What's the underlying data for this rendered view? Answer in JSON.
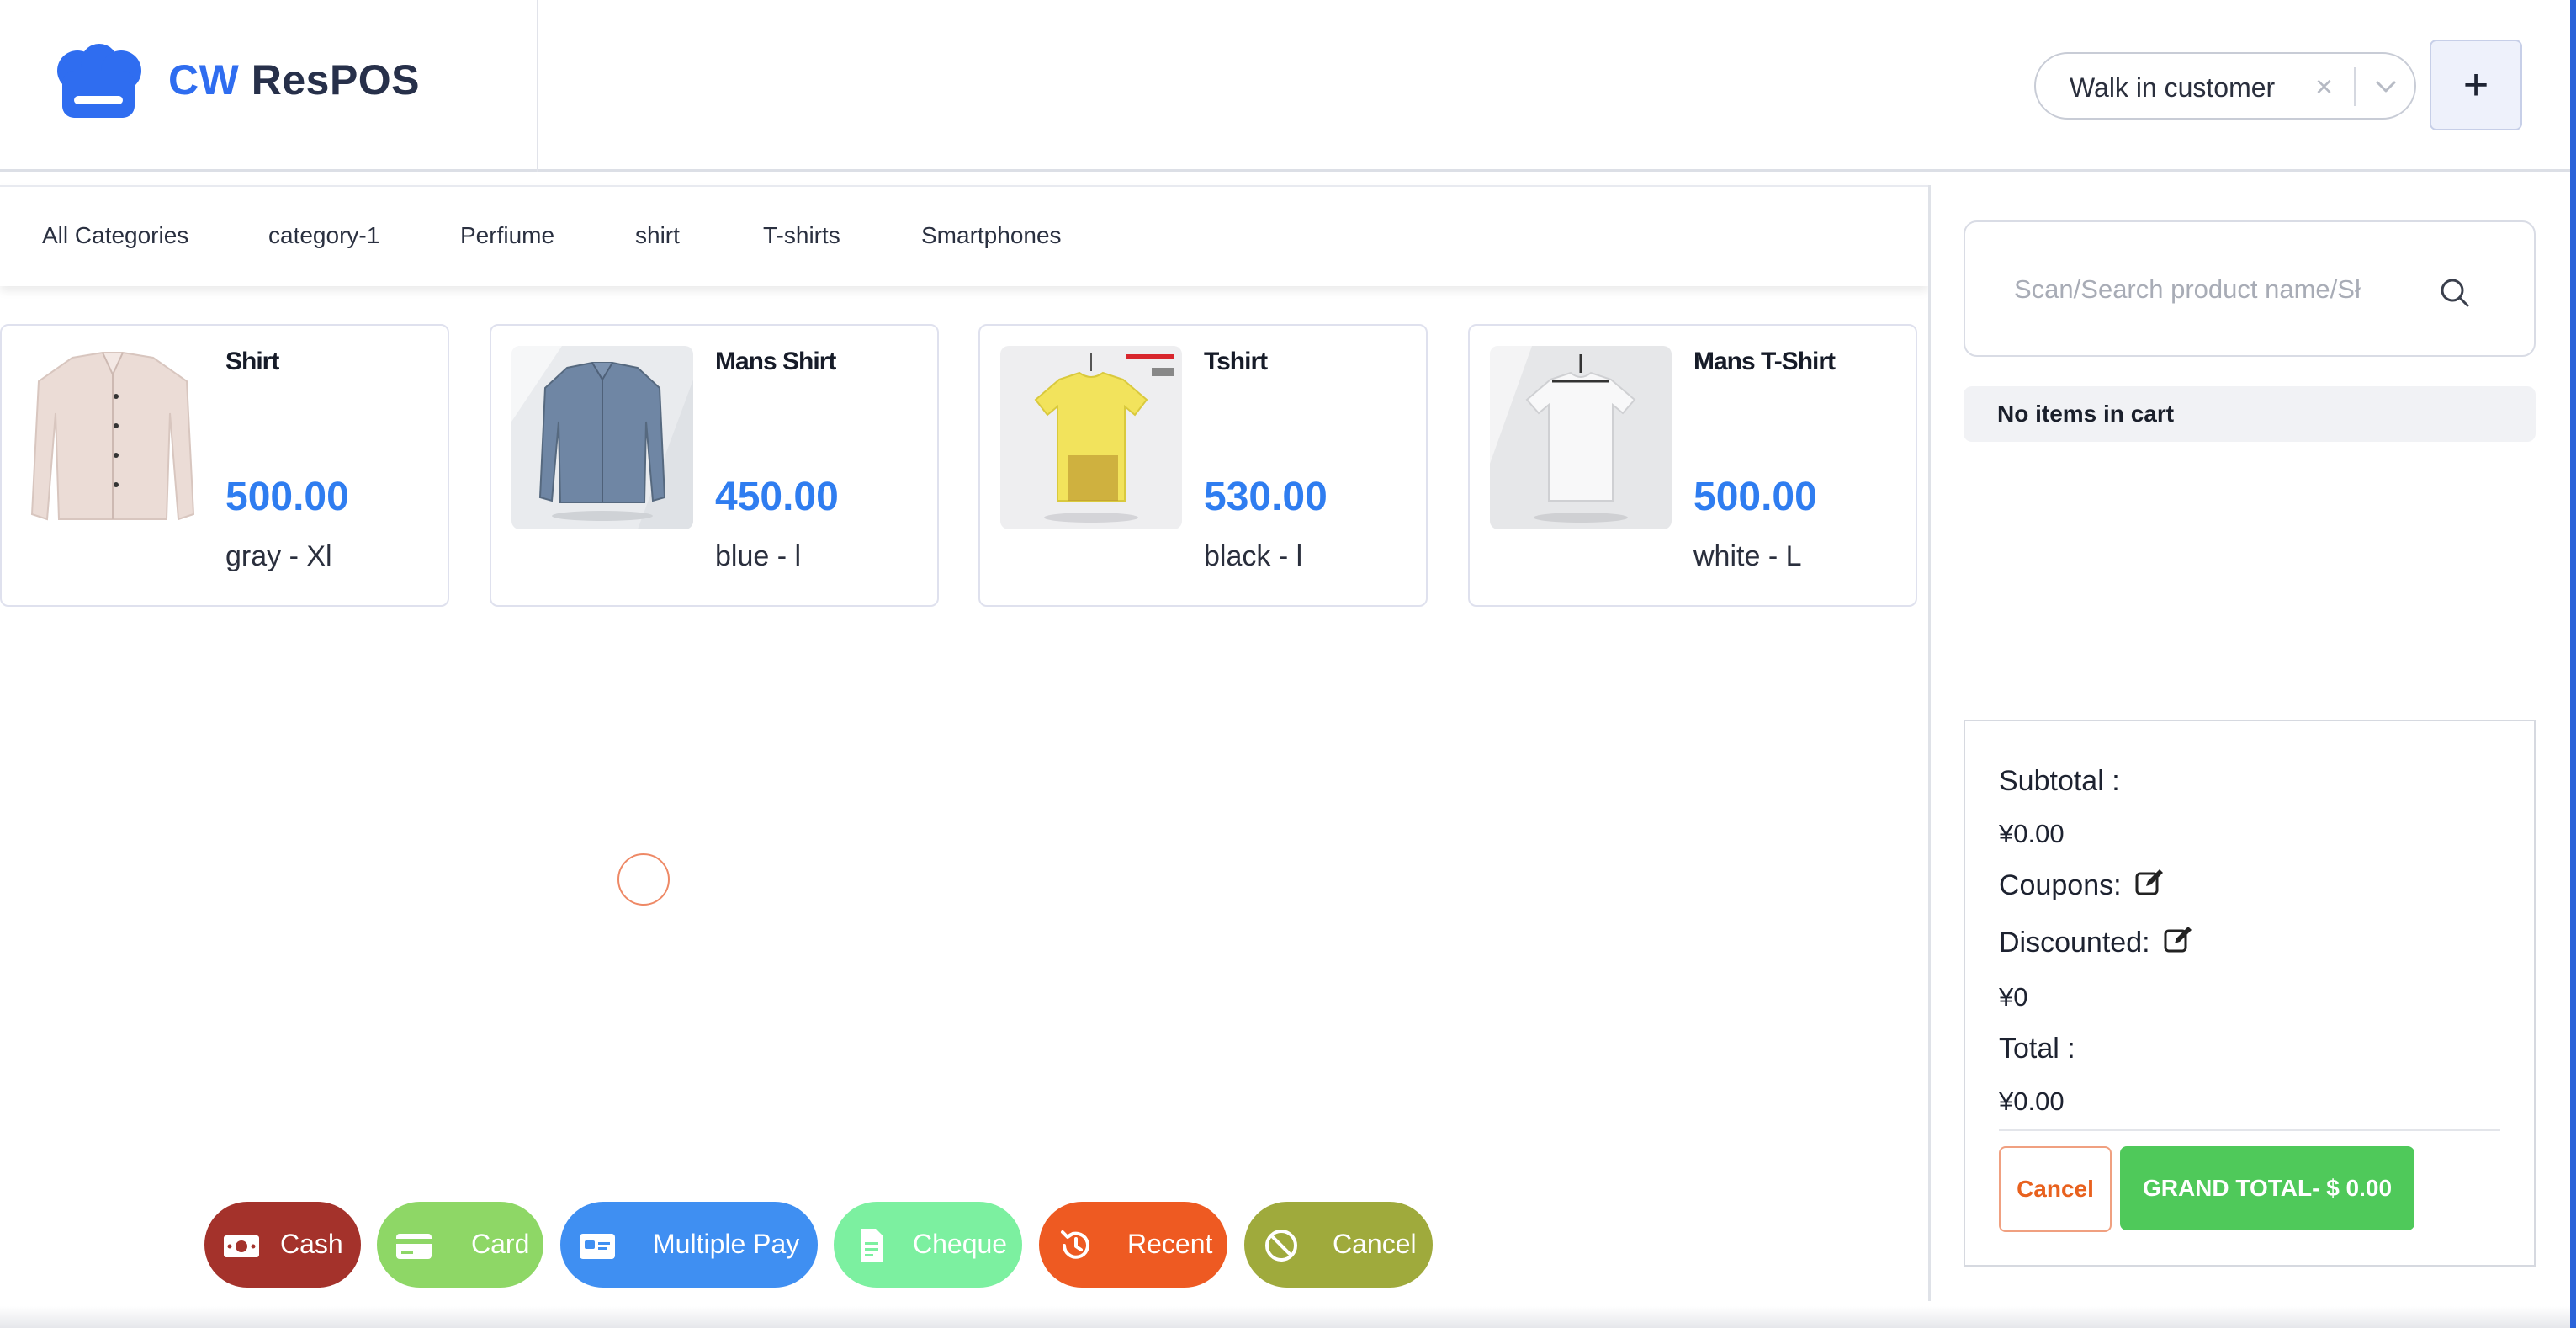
{
  "brand": {
    "cw": "CW",
    "res": "ResPOS"
  },
  "customer": {
    "selected": "Walk in customer",
    "clear": "×"
  },
  "add_button": "+",
  "categories": [
    "All Categories",
    "category-1",
    "Perfiume",
    "shirt",
    "T-shirts",
    "Smartphones"
  ],
  "products": [
    {
      "name": "Shirt",
      "price": "500.00",
      "variant": "gray - Xl",
      "image": "shirt-image"
    },
    {
      "name": "Mans Shirt",
      "price": "450.00",
      "variant": "blue - l",
      "image": "mans-shirt-image"
    },
    {
      "name": "Tshirt",
      "price": "530.00",
      "variant": "black - l",
      "image": "tshirt-image"
    },
    {
      "name": "Mans T-Shirt",
      "price": "500.00",
      "variant": "white - L",
      "image": "mans-tshirt-image"
    }
  ],
  "search": {
    "placeholder": "Scan/Search product name/Sł"
  },
  "cart": {
    "empty_text": "No items in cart"
  },
  "summary": {
    "subtotal_label": "Subtotal :",
    "subtotal_value": "¥0.00",
    "coupons_label": "Coupons:",
    "discounted_label": "Discounted:",
    "discounted_value": "¥0",
    "total_label": "Total :",
    "total_value": "¥0.00",
    "cancel_label": "Cancel",
    "grand_total_label": "GRAND TOTAL- $ 0.00"
  },
  "payments": [
    {
      "label": "Cash",
      "icon": "cash-icon",
      "color": "#a4322b"
    },
    {
      "label": "Card",
      "icon": "card-icon",
      "color": "#8ed766"
    },
    {
      "label": "Multiple Pay",
      "icon": "multiple-pay-icon",
      "color": "#3f8ff2"
    },
    {
      "label": "Cheque",
      "icon": "cheque-icon",
      "color": "#7cf0a0"
    },
    {
      "label": "Recent",
      "icon": "history-icon",
      "color": "#ee5a22"
    },
    {
      "label": "Cancel",
      "icon": "ban-icon",
      "color": "#9faa3c"
    }
  ],
  "colors": {
    "accent": "#2f6df0",
    "price": "#2f7df0",
    "grand_total": "#4fc95a"
  }
}
